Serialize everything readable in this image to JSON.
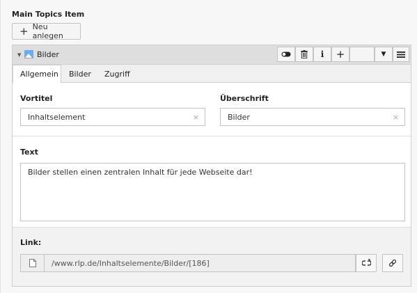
{
  "section": {
    "title": "Main Topics Item"
  },
  "new_button": {
    "icon": "plus-icon",
    "label": "Neu anlegen"
  },
  "panel": {
    "title": "Bilder",
    "header_icons": [
      "chevron-down-icon",
      "image-icon",
      "toggle-icon",
      "trash-icon",
      "info-icon",
      "plus-icon",
      "move-icon",
      "menu-icon"
    ],
    "controls": {
      "info": "i",
      "add": "+"
    }
  },
  "tabs": [
    {
      "label": "Allgemein",
      "active": true
    },
    {
      "label": "Bilder",
      "active": false
    },
    {
      "label": "Zugriff",
      "active": false
    }
  ],
  "fields": {
    "vortitel": {
      "label": "Vortitel",
      "value": "Inhaltselement"
    },
    "ueberschrift": {
      "label": "Überschrift",
      "value": "Bilder"
    },
    "text": {
      "label": "Text",
      "value": "Bilder stellen einen zentralen Inhalt für jede Webseite dar!"
    },
    "link": {
      "label": "Link:",
      "value": "/www.rlp.de/Inhaltselemente/Bilder/[186]"
    }
  },
  "clear_glyph": "×",
  "colors": {
    "header_bg": "#dedede",
    "accent_icon": "#6aaef0",
    "border": "#c3c3c3"
  }
}
